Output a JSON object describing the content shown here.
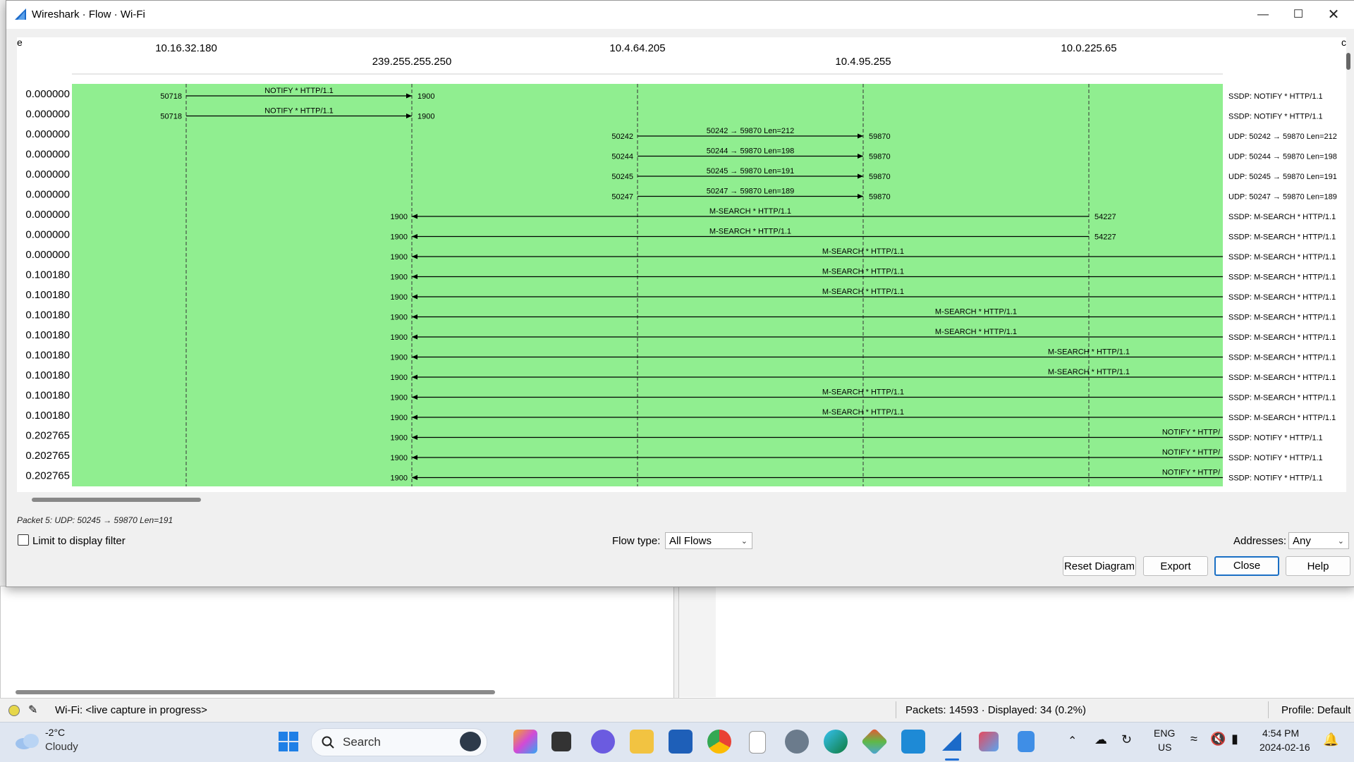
{
  "dialog": {
    "title": "Wireshark · Flow · Wi-Fi",
    "corner_left": "e",
    "corner_right": "c"
  },
  "hosts": [
    {
      "label": "10.16.32.180",
      "row": 0
    },
    {
      "label": "239.255.255.250",
      "row": 1
    },
    {
      "label": "10.4.64.205",
      "row": 0
    },
    {
      "label": "10.4.95.255",
      "row": 1
    },
    {
      "label": "10.0.225.65",
      "row": 0
    }
  ],
  "flows": [
    {
      "time": "0.000000",
      "from": 0,
      "to": 1,
      "src_port": "50718",
      "dst_port": "1900",
      "label": "NOTIFY * HTTP/1.1",
      "comment": "SSDP: NOTIFY * HTTP/1.1"
    },
    {
      "time": "0.000000",
      "from": 0,
      "to": 1,
      "src_port": "50718",
      "dst_port": "1900",
      "label": "NOTIFY * HTTP/1.1",
      "comment": "SSDP: NOTIFY * HTTP/1.1"
    },
    {
      "time": "0.000000",
      "from": 2,
      "to": 3,
      "src_port": "50242",
      "dst_port": "59870",
      "label": "50242 → 59870 Len=212",
      "comment": "UDP: 50242 → 59870 Len=212"
    },
    {
      "time": "0.000000",
      "from": 2,
      "to": 3,
      "src_port": "50244",
      "dst_port": "59870",
      "label": "50244 → 59870 Len=198",
      "comment": "UDP: 50244 → 59870 Len=198"
    },
    {
      "time": "0.000000",
      "from": 2,
      "to": 3,
      "src_port": "50245",
      "dst_port": "59870",
      "label": "50245 → 59870 Len=191",
      "comment": "UDP: 50245 → 59870 Len=191"
    },
    {
      "time": "0.000000",
      "from": 2,
      "to": 3,
      "src_port": "50247",
      "dst_port": "59870",
      "label": "50247 → 59870 Len=189",
      "comment": "UDP: 50247 → 59870 Len=189"
    },
    {
      "time": "0.000000",
      "from": 4,
      "to": 1,
      "src_port": "54227",
      "dst_port": "1900",
      "label": "M-SEARCH * HTTP/1.1",
      "comment": "SSDP: M-SEARCH * HTTP/1.1"
    },
    {
      "time": "0.000000",
      "from": 4,
      "to": 1,
      "src_port": "54227",
      "dst_port": "1900",
      "label": "M-SEARCH * HTTP/1.1",
      "comment": "SSDP: M-SEARCH * HTTP/1.1"
    },
    {
      "time": "0.000000",
      "from": 5,
      "to": 1,
      "src_port": "",
      "dst_port": "1900",
      "label": "M-SEARCH * HTTP/1.1",
      "comment": "SSDP: M-SEARCH * HTTP/1.1"
    },
    {
      "time": "0.100180",
      "from": 5,
      "to": 1,
      "src_port": "",
      "dst_port": "1900",
      "label": "M-SEARCH * HTTP/1.1",
      "comment": "SSDP: M-SEARCH * HTTP/1.1"
    },
    {
      "time": "0.100180",
      "from": 5,
      "to": 1,
      "src_port": "",
      "dst_port": "1900",
      "label": "M-SEARCH * HTTP/1.1",
      "comment": "SSDP: M-SEARCH * HTTP/1.1"
    },
    {
      "time": "0.100180",
      "from": 6,
      "to": 1,
      "src_port": "",
      "dst_port": "1900",
      "label": "M-SEARCH * HTTP/1.1",
      "comment": "SSDP: M-SEARCH * HTTP/1.1"
    },
    {
      "time": "0.100180",
      "from": 6,
      "to": 1,
      "src_port": "",
      "dst_port": "1900",
      "label": "M-SEARCH * HTTP/1.1",
      "comment": "SSDP: M-SEARCH * HTTP/1.1"
    },
    {
      "time": "0.100180",
      "from": 7,
      "to": 1,
      "src_port": "",
      "dst_port": "1900",
      "label": "M-SEARCH * HTTP/1.1",
      "comment": "SSDP: M-SEARCH * HTTP/1.1"
    },
    {
      "time": "0.100180",
      "from": 7,
      "to": 1,
      "src_port": "",
      "dst_port": "1900",
      "label": "M-SEARCH * HTTP/1.1",
      "comment": "SSDP: M-SEARCH * HTTP/1.1"
    },
    {
      "time": "0.100180",
      "from": 5,
      "to": 1,
      "src_port": "",
      "dst_port": "1900",
      "label": "M-SEARCH * HTTP/1.1",
      "comment": "SSDP: M-SEARCH * HTTP/1.1"
    },
    {
      "time": "0.100180",
      "from": 5,
      "to": 1,
      "src_port": "",
      "dst_port": "1900",
      "label": "M-SEARCH * HTTP/1.1",
      "comment": "SSDP: M-SEARCH * HTTP/1.1"
    },
    {
      "time": "0.202765",
      "from": 8,
      "to": 1,
      "src_port": "",
      "dst_port": "1900",
      "label": "NOTIFY * HTTP/",
      "comment": "SSDP: NOTIFY * HTTP/1.1"
    },
    {
      "time": "0.202765",
      "from": 8,
      "to": 1,
      "src_port": "",
      "dst_port": "1900",
      "label": "NOTIFY * HTTP/",
      "comment": "SSDP: NOTIFY * HTTP/1.1"
    },
    {
      "time": "0.202765",
      "from": 8,
      "to": 1,
      "src_port": "",
      "dst_port": "1900",
      "label": "NOTIFY * HTTP/",
      "comment": "SSDP: NOTIFY * HTTP/1.1"
    }
  ],
  "packet_info": "Packet 5: UDP: 50245 → 59870 Len=191",
  "controls": {
    "limit_label": "Limit to display filter",
    "limit_checked": false,
    "flow_type_label": "Flow type:",
    "flow_type_value": "All Flows",
    "addresses_label": "Addresses:",
    "addresses_value": "Any",
    "reset_label": "Reset Diagram",
    "export_label": "Export",
    "close_label": "Close",
    "help_label": "Help"
  },
  "status_bar": {
    "interface": "Wi-Fi: <live capture in progress>",
    "packets": "Packets: 14593 · Displayed: 34 (0.2%)",
    "profile": "Profile: Default"
  },
  "taskbar": {
    "weather_temp": "-2°C",
    "weather_desc": "Cloudy",
    "search_placeholder": "Search",
    "lang": "ENG",
    "region": "US",
    "time": "4:54 PM",
    "date": "2024-02-16"
  },
  "colors": {
    "flow_bg": "#90ee90",
    "accent": "#1a6fc4"
  }
}
